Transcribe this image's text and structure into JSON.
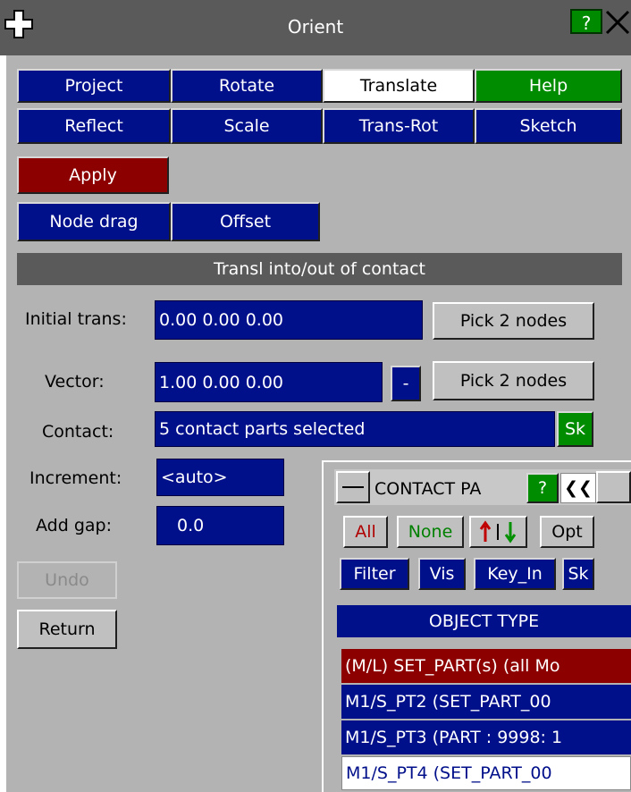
{
  "window": {
    "title": "Orient",
    "help_label": "?",
    "move_icon": "move-icon",
    "close_icon": "close-icon"
  },
  "mode_buttons": {
    "project": "Project",
    "rotate": "Rotate",
    "translate": "Translate",
    "help": "Help",
    "reflect": "Reflect",
    "scale": "Scale",
    "trans_rot": "Trans-Rot",
    "sketch": "Sketch"
  },
  "actions": {
    "apply": "Apply",
    "node_drag": "Node drag",
    "offset": "Offset"
  },
  "section": {
    "title": "Transl into/out of contact"
  },
  "form": {
    "initial_trans_label": "Initial trans:",
    "initial_trans_value": "0.00 0.00 0.00",
    "pick_nodes_1": "Pick 2 nodes",
    "vector_label": "Vector:",
    "vector_value": "1.00 0.00 0.00",
    "vector_minus": "-",
    "pick_nodes_2": "Pick 2 nodes",
    "contact_label": "Contact:",
    "contact_value": "5 contact parts selected",
    "contact_sk": "Sk",
    "increment_label": "Increment:",
    "increment_value": "<auto>",
    "add_gap_label": "Add gap:",
    "add_gap_value": "0.0"
  },
  "bottom_buttons": {
    "undo": "Undo",
    "return": "Return"
  },
  "sub_window": {
    "title": "CONTACT PA",
    "help_label": "?",
    "collapse_label": "❮❮",
    "all": "All",
    "none": "None",
    "opt": "Opt",
    "filter": "Filter",
    "vis": "Vis",
    "key_in": "Key_In",
    "sk": "Sk",
    "object_type_header": "OBJECT TYPE",
    "items": [
      {
        "label": "(M/L) SET_PART(s) (all Mo"
      },
      {
        "label": "M1/S_PT2 (SET_PART_00"
      },
      {
        "label": "M1/S_PT3 (PART : 9998: 1"
      },
      {
        "label": "M1/S_PT4 (SET_PART_00"
      }
    ]
  }
}
